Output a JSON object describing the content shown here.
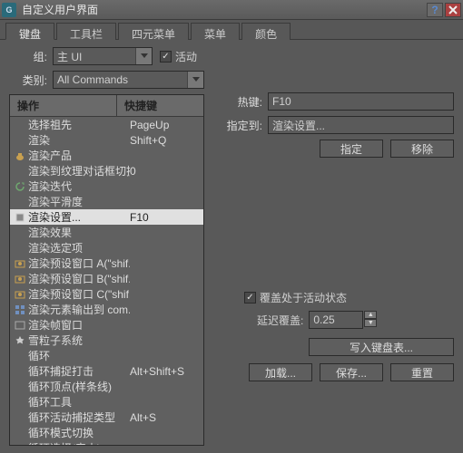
{
  "window": {
    "title": "自定义用户界面"
  },
  "tabs": [
    "键盘",
    "工具栏",
    "四元菜单",
    "菜单",
    "颜色"
  ],
  "active_tab": 0,
  "group": {
    "label": "组:",
    "value": "主 UI",
    "active_label": "活动",
    "active": true
  },
  "category": {
    "label": "类别:",
    "value": "All Commands"
  },
  "list": {
    "header": {
      "c1": "操作",
      "c2": "快捷键"
    },
    "items": [
      {
        "icon": "",
        "t1": "选择祖先",
        "t2": "PageUp"
      },
      {
        "icon": "",
        "t1": "渲染",
        "t2": "Shift+Q"
      },
      {
        "icon": "teapot",
        "t1": "渲染产品",
        "t2": ""
      },
      {
        "icon": "",
        "t1": "渲染到纹理对话框切换",
        "t2": "0"
      },
      {
        "icon": "cycle",
        "t1": "渲染迭代",
        "t2": ""
      },
      {
        "icon": "",
        "t1": "渲染平滑度",
        "t2": ""
      },
      {
        "icon": "settings",
        "t1": "渲染设置...",
        "t2": "F10",
        "sel": true
      },
      {
        "icon": "",
        "t1": "渲染效果",
        "t2": ""
      },
      {
        "icon": "",
        "t1": "渲染选定项",
        "t2": ""
      },
      {
        "icon": "preset",
        "t1": "渲染预设窗口 A(\"shif...",
        "t2": ""
      },
      {
        "icon": "preset",
        "t1": "渲染预设窗口 B(\"shif...",
        "t2": ""
      },
      {
        "icon": "preset",
        "t1": "渲染预设窗口 C(\"shif...",
        "t2": ""
      },
      {
        "icon": "elem",
        "t1": "渲染元素输出到 com...",
        "t2": ""
      },
      {
        "icon": "frame",
        "t1": "渲染帧窗口",
        "t2": ""
      },
      {
        "icon": "star",
        "t1": "雪粒子系统",
        "t2": ""
      },
      {
        "icon": "",
        "t1": "循环",
        "t2": ""
      },
      {
        "icon": "",
        "t1": "循环捕捉打击",
        "t2": "Alt+Shift+S"
      },
      {
        "icon": "",
        "t1": "循环顶点(样条线)",
        "t2": ""
      },
      {
        "icon": "",
        "t1": "循环工具",
        "t2": ""
      },
      {
        "icon": "",
        "t1": "循环活动捕捉类型",
        "t2": "Alt+S"
      },
      {
        "icon": "",
        "t1": "循环模式切换",
        "t2": ""
      },
      {
        "icon": "",
        "t1": "循环选择(帝山)",
        "t2": ""
      }
    ]
  },
  "hotkey": {
    "label": "热键:",
    "value": "F10"
  },
  "assigned": {
    "label": "指定到:",
    "value": "渲染设置..."
  },
  "buttons": {
    "assign": "指定",
    "remove": "移除"
  },
  "override": {
    "label": "覆盖处于活动状态",
    "checked": true
  },
  "delay": {
    "label": "延迟覆盖:",
    "value": "0.25"
  },
  "write_table": "写入键盘表...",
  "footer": {
    "load": "加载...",
    "save": "保存...",
    "reset": "重置"
  }
}
